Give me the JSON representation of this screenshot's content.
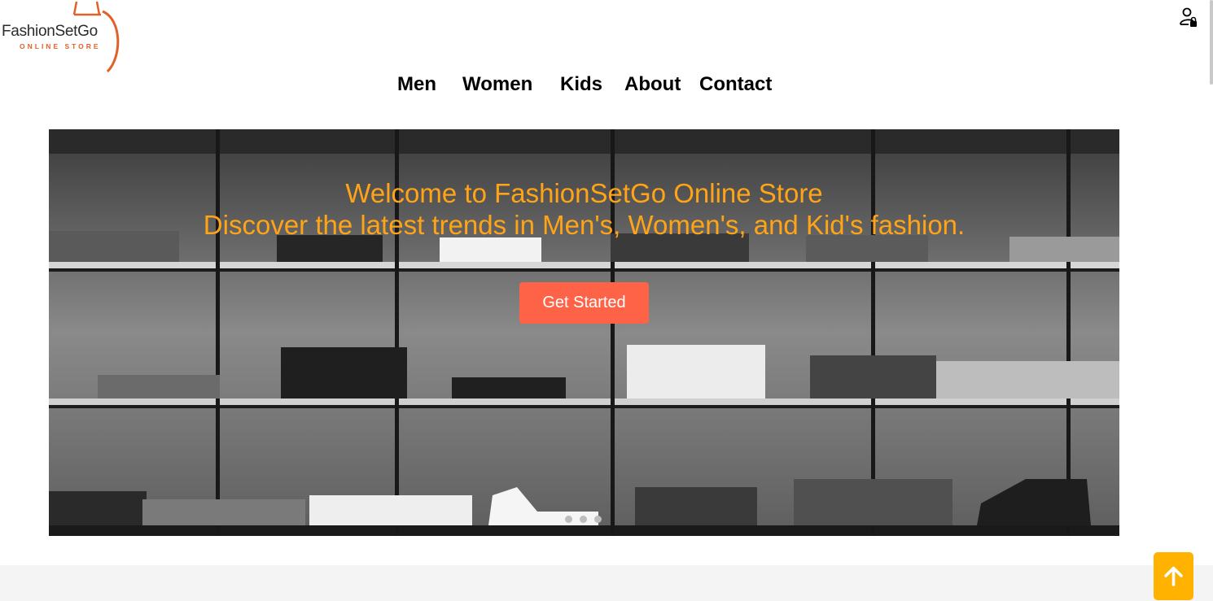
{
  "brand": {
    "name": "FashionSetGo",
    "tagline": "ONLINE STORE",
    "accent_color": "#e0622a"
  },
  "header": {
    "user_icon": "user-lock-icon"
  },
  "nav": {
    "items": [
      {
        "label": "Men"
      },
      {
        "label": "Women"
      },
      {
        "label": "Kids"
      },
      {
        "label": "About"
      },
      {
        "label": "Contact"
      }
    ]
  },
  "hero": {
    "title_line1": "Welcome to FashionSetGo Online Store",
    "title_line2": "Discover the latest trends in Men's, Women's, and Kid's fashion.",
    "title_color": "#ffa416",
    "cta_label": "Get Started",
    "cta_color": "#ff6347",
    "slides_count": 3,
    "background_icon": "clothing-shelves-photo"
  },
  "scroll_top": {
    "icon": "arrow-up-icon",
    "color": "#ffb300"
  }
}
